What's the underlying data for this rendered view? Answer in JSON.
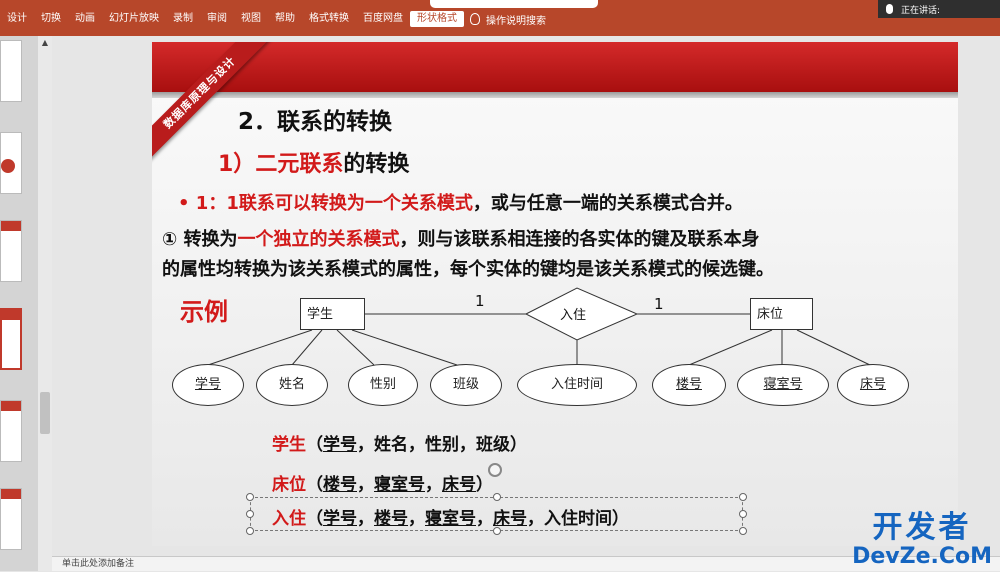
{
  "ribbon": {
    "tabs": [
      "设计",
      "切换",
      "动画",
      "幻灯片放映",
      "录制",
      "审阅",
      "视图",
      "帮助",
      "格式转换",
      "百度网盘",
      "形状格式"
    ],
    "active_tab": "形状格式",
    "tell_me": "操作说明搜索"
  },
  "speaker_label": "正在讲话:",
  "slide": {
    "sash": "数据库原理与设计",
    "heading": "2．联系的转换",
    "subheading_prefix": "1）",
    "subheading_red": "二元联系",
    "subheading_rest": "的转换",
    "bullet_marker": "•",
    "bullet_red": "1：1联系可以转换为一个关系模式",
    "bullet_rest": "，或与任意一端的关系模式合并。",
    "para1_prefix": "① 转换为",
    "para1_red": "一个独立的关系模式",
    "para1_rest": "，则与该联系相连接的各实体的键及联系本身",
    "para2": "的属性均转换为该关系模式的属性，每个实体的键均是该关系模式的候选键。",
    "example_label": "示例",
    "er": {
      "entity_left": "学生",
      "relationship": "入住",
      "entity_right": "床位",
      "card_left": "1",
      "card_right": "1",
      "attributes": [
        "学号",
        "姓名",
        "性别",
        "班级",
        "入住时间",
        "楼号",
        "寝室号",
        "床号"
      ]
    },
    "schemas": [
      {
        "name": "学生",
        "open": "（",
        "keys": [
          "学号"
        ],
        "rest": "，姓名，性别，班级）"
      },
      {
        "name": "床位",
        "open": "（",
        "keys": [
          "楼号",
          "寝室号",
          "床号"
        ],
        "rest": "）"
      },
      {
        "name": "入住",
        "open": "（",
        "keys": [
          "学号",
          "楼号",
          "寝室号",
          "床号"
        ],
        "rest": "，入住时间）"
      }
    ]
  },
  "notes_placeholder": "单击此处添加备注",
  "watermark": {
    "cn": "开发者",
    "en": "DevZe.CoM"
  },
  "colors": {
    "ribbon": "#b7472a",
    "accent_red": "#d21a1a",
    "watermark_blue": "#1565c0"
  }
}
